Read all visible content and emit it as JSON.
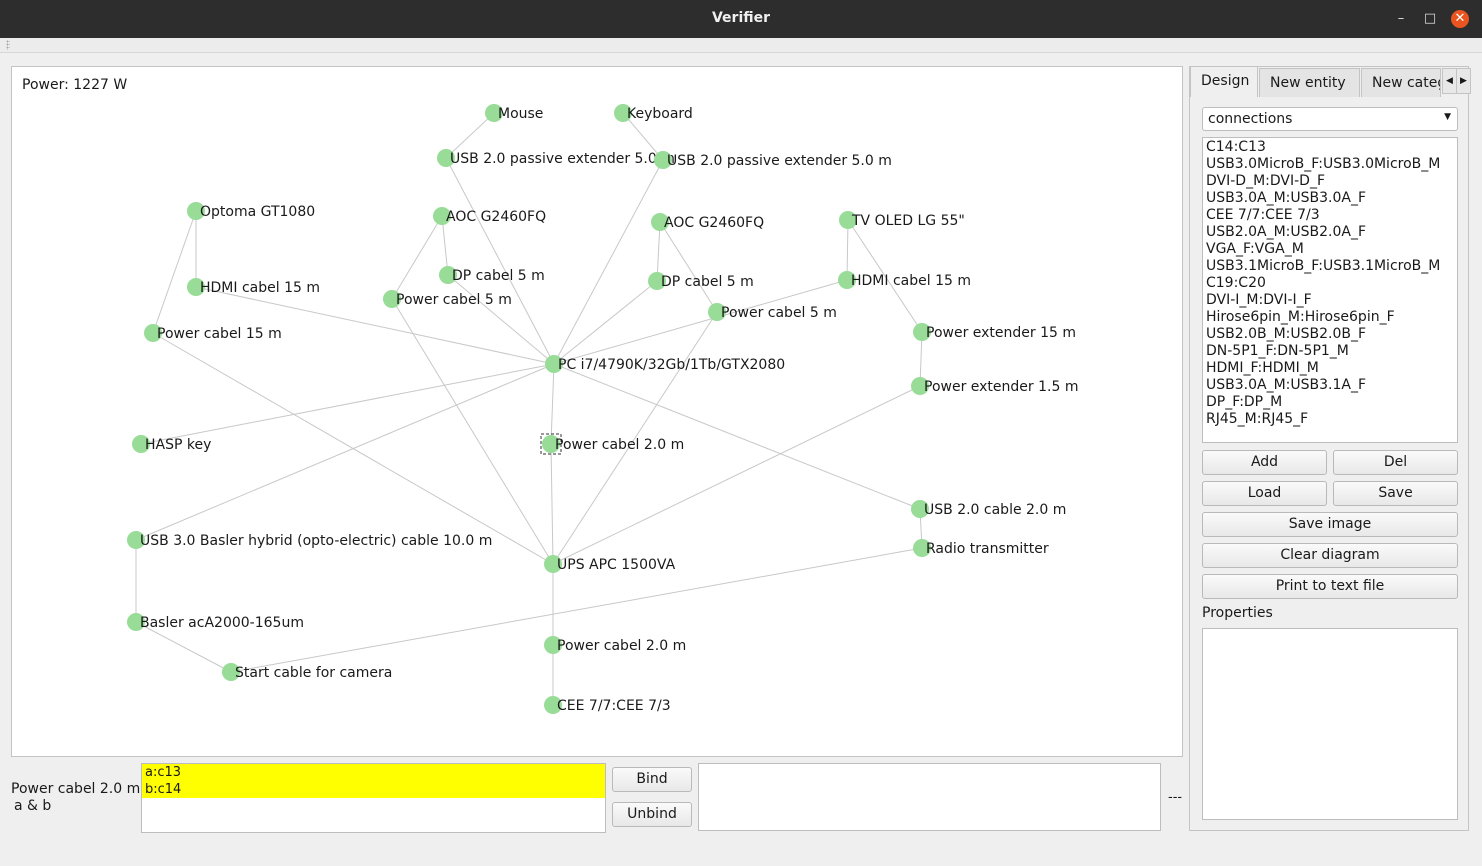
{
  "window": {
    "title": "Verifier",
    "minimize": "–",
    "maximize": "□",
    "close": "✕"
  },
  "diagram": {
    "power": "Power: 1227 W",
    "nodes": [
      {
        "id": "mouse",
        "label": "Mouse"
      },
      {
        "id": "keyboard",
        "label": "Keyboard"
      },
      {
        "id": "usbext1",
        "label": "USB 2.0 passive extender 5.0 m"
      },
      {
        "id": "usbext2",
        "label": "USB 2.0 passive extender 5.0 m"
      },
      {
        "id": "optoma",
        "label": "Optoma GT1080"
      },
      {
        "id": "aoc1",
        "label": "AOC G2460FQ"
      },
      {
        "id": "aoc2",
        "label": "AOC G2460FQ"
      },
      {
        "id": "tv",
        "label": "TV OLED LG 55\""
      },
      {
        "id": "hdmi1",
        "label": "HDMI cabel 15 m"
      },
      {
        "id": "dp1",
        "label": "DP cabel 5 m"
      },
      {
        "id": "dp2",
        "label": "DP cabel 5 m"
      },
      {
        "id": "hdmi2",
        "label": "HDMI cabel 15 m"
      },
      {
        "id": "pwr5a",
        "label": "Power cabel 5 m"
      },
      {
        "id": "pwr5b",
        "label": "Power cabel 5 m"
      },
      {
        "id": "pwr15",
        "label": "Power cabel 15 m"
      },
      {
        "id": "pwrext15",
        "label": "Power extender 15 m"
      },
      {
        "id": "pc",
        "label": "PC i7/4790K/32Gb/1Tb/GTX2080"
      },
      {
        "id": "pwrext1",
        "label": "Power extender 1.5 m"
      },
      {
        "id": "hasp",
        "label": "HASP key"
      },
      {
        "id": "pwr2a",
        "label": "Power cabel 2.0 m"
      },
      {
        "id": "usb2",
        "label": "USB 2.0 cable 2.0 m"
      },
      {
        "id": "basler_cable",
        "label": "USB 3.0 Basler hybrid (opto-electric) cable 10.0 m"
      },
      {
        "id": "ups",
        "label": "UPS APC 1500VA"
      },
      {
        "id": "radio",
        "label": "Radio transmitter"
      },
      {
        "id": "basler",
        "label": "Basler acA2000-165um"
      },
      {
        "id": "pwr2b",
        "label": "Power cabel 2.0 m"
      },
      {
        "id": "start",
        "label": "Start cable for camera"
      },
      {
        "id": "cee",
        "label": "CEE 7/7:CEE 7/3"
      }
    ],
    "edges": [
      [
        "mouse",
        "usbext1"
      ],
      [
        "usbext1",
        "pc"
      ],
      [
        "keyboard",
        "usbext2"
      ],
      [
        "usbext2",
        "pc"
      ],
      [
        "optoma",
        "hdmi1"
      ],
      [
        "optoma",
        "pwr15"
      ],
      [
        "hdmi1",
        "pc"
      ],
      [
        "pwr15",
        "ups"
      ],
      [
        "aoc1",
        "dp1"
      ],
      [
        "aoc1",
        "pwr5a"
      ],
      [
        "dp1",
        "pc"
      ],
      [
        "pwr5a",
        "ups"
      ],
      [
        "aoc2",
        "dp2"
      ],
      [
        "aoc2",
        "pwr5b"
      ],
      [
        "dp2",
        "pc"
      ],
      [
        "pwr5b",
        "ups"
      ],
      [
        "tv",
        "hdmi2"
      ],
      [
        "hdmi2",
        "pc"
      ],
      [
        "tv",
        "pwrext15"
      ],
      [
        "pwrext15",
        "pwrext1"
      ],
      [
        "pwrext1",
        "ups"
      ],
      [
        "hasp",
        "pc"
      ],
      [
        "pc",
        "pwr2a"
      ],
      [
        "pwr2a",
        "ups"
      ],
      [
        "pc",
        "usb2"
      ],
      [
        "usb2",
        "radio"
      ],
      [
        "pc",
        "basler_cable"
      ],
      [
        "basler_cable",
        "basler"
      ],
      [
        "basler",
        "start"
      ],
      [
        "start",
        "radio"
      ],
      [
        "ups",
        "pwr2b"
      ],
      [
        "pwr2b",
        "cee"
      ]
    ],
    "selected": "pwr2a"
  },
  "binding": {
    "node_label": "Power cabel 2.0 m",
    "pins_label": "a & b",
    "pins": [
      "a:c13",
      "b:c14"
    ],
    "bind_label": "Bind",
    "unbind_label": "Unbind",
    "status": "---"
  },
  "panel": {
    "tabs": [
      "Design",
      "New entity",
      "New categ"
    ],
    "combo_value": "connections",
    "connections": [
      "C14:C13",
      "USB3.0MicroB_F:USB3.0MicroB_M",
      "DVI-D_M:DVI-D_F",
      "USB3.0A_M:USB3.0A_F",
      "CEE 7/7:CEE 7/3",
      "USB2.0A_M:USB2.0A_F",
      "VGA_F:VGA_M",
      "USB3.1MicroB_F:USB3.1MicroB_M",
      "C19:C20",
      "DVI-I_M:DVI-I_F",
      "Hirose6pin_M:Hirose6pin_F",
      "USB2.0B_M:USB2.0B_F",
      "DN-5P1_F:DN-5P1_M",
      "HDMI_F:HDMI_M",
      "USB3.0A_M:USB3.1A_F",
      "DP_F:DP_M",
      "RJ45_M:RJ45_F"
    ],
    "add_label": "Add",
    "del_label": "Del",
    "load_label": "Load",
    "save_label": "Save",
    "save_image_label": "Save image",
    "clear_label": "Clear diagram",
    "print_label": "Print to text file",
    "properties_label": "Properties"
  },
  "colors": {
    "node": "#98dc98",
    "edge": "#c8c8c8",
    "pin_highlight": "#ffff00",
    "close": "#e95420"
  }
}
